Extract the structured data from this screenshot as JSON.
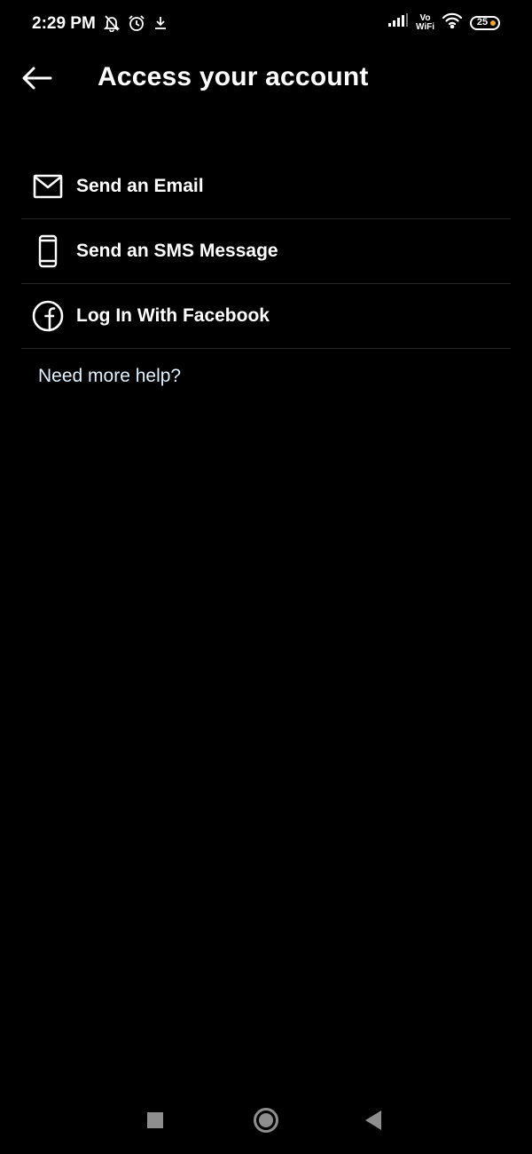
{
  "status_bar": {
    "time": "2:29 PM",
    "vowifi_top": "Vo",
    "vowifi_bottom": "WiFi",
    "battery_level": "25",
    "left_icons": [
      "bell-off-icon",
      "alarm-icon",
      "download-icon"
    ],
    "right_icons": [
      "signal-icon",
      "vowifi-icon",
      "wifi-icon",
      "battery-icon"
    ]
  },
  "header": {
    "back_icon": "arrow-left-icon",
    "title": "Access your account"
  },
  "options": [
    {
      "label": "Send an Email",
      "icon": "mail-icon"
    },
    {
      "label": "Send an SMS Message",
      "icon": "phone-icon"
    },
    {
      "label": "Log In With Facebook",
      "icon": "facebook-icon"
    }
  ],
  "help": {
    "label": "Need more help?"
  },
  "nav_bar": {
    "icons": [
      "recents-square-icon",
      "home-circle-icon",
      "back-triangle-icon"
    ]
  },
  "colors": {
    "background": "#000000",
    "text": "#ffffff",
    "divider": "#262626",
    "link": "#e0f1ff",
    "nav": "#8e8e8e",
    "battery_accent": "#f5a623"
  }
}
